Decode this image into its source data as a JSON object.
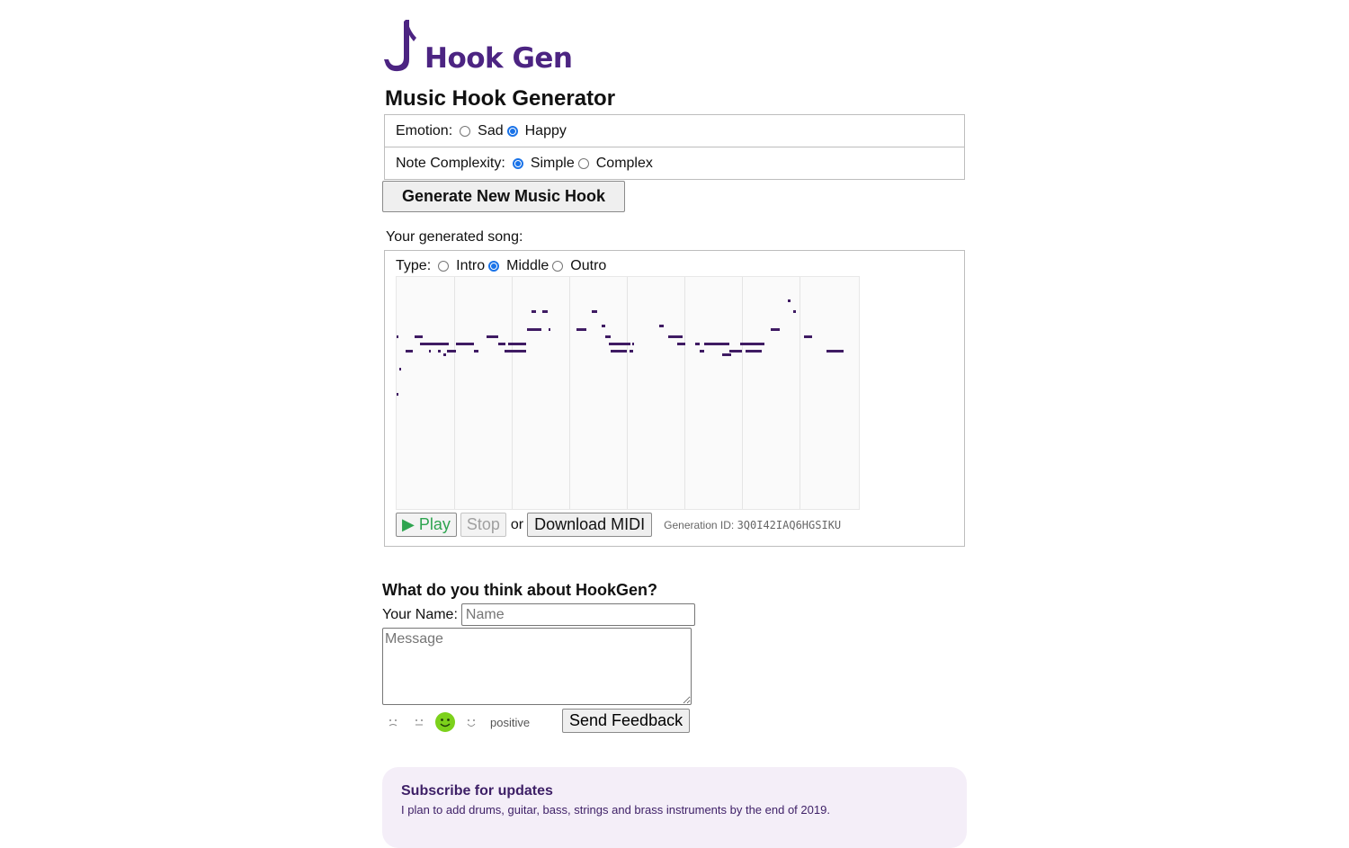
{
  "brand": {
    "name": "Hook Gen",
    "color": "#4c2482",
    "icon": "music-note-hook-icon"
  },
  "page": {
    "title": "Music Hook Generator"
  },
  "options": {
    "emotion": {
      "label": "Emotion:",
      "choices": [
        "Sad",
        "Happy"
      ],
      "selected": "Happy"
    },
    "complexity": {
      "label": "Note Complexity:",
      "choices": [
        "Simple",
        "Complex"
      ],
      "selected": "Simple"
    }
  },
  "generate_button": "Generate New Music Hook",
  "song": {
    "label": "Your generated song:",
    "type": {
      "label": "Type:",
      "choices": [
        "Intro",
        "Middle",
        "Outro"
      ],
      "selected": "Middle"
    },
    "play_label": "▶ Play",
    "stop_label": " Stop",
    "or_label": "or",
    "download_label": "Download MIDI",
    "generation_id_label": "Generation ID:",
    "generation_id": "3Q0I42IAQ6HGSIKU",
    "note_color": "#3f1b63"
  },
  "feedback": {
    "title": "What do you think about HookGen?",
    "name_label": "Your Name:",
    "name_placeholder": "Name",
    "message_placeholder": "Message",
    "sentiment_faces": [
      "very-negative-face-icon",
      "neutral-face-icon",
      "positive-face-icon",
      "very-positive-face-icon"
    ],
    "selected_sentiment": "positive",
    "send_label": "Send Feedback"
  },
  "subscribe": {
    "title": "Subscribe for updates",
    "text": "I plan to add drums, guitar, bass, strings and brass instruments by the end of 2019."
  }
}
